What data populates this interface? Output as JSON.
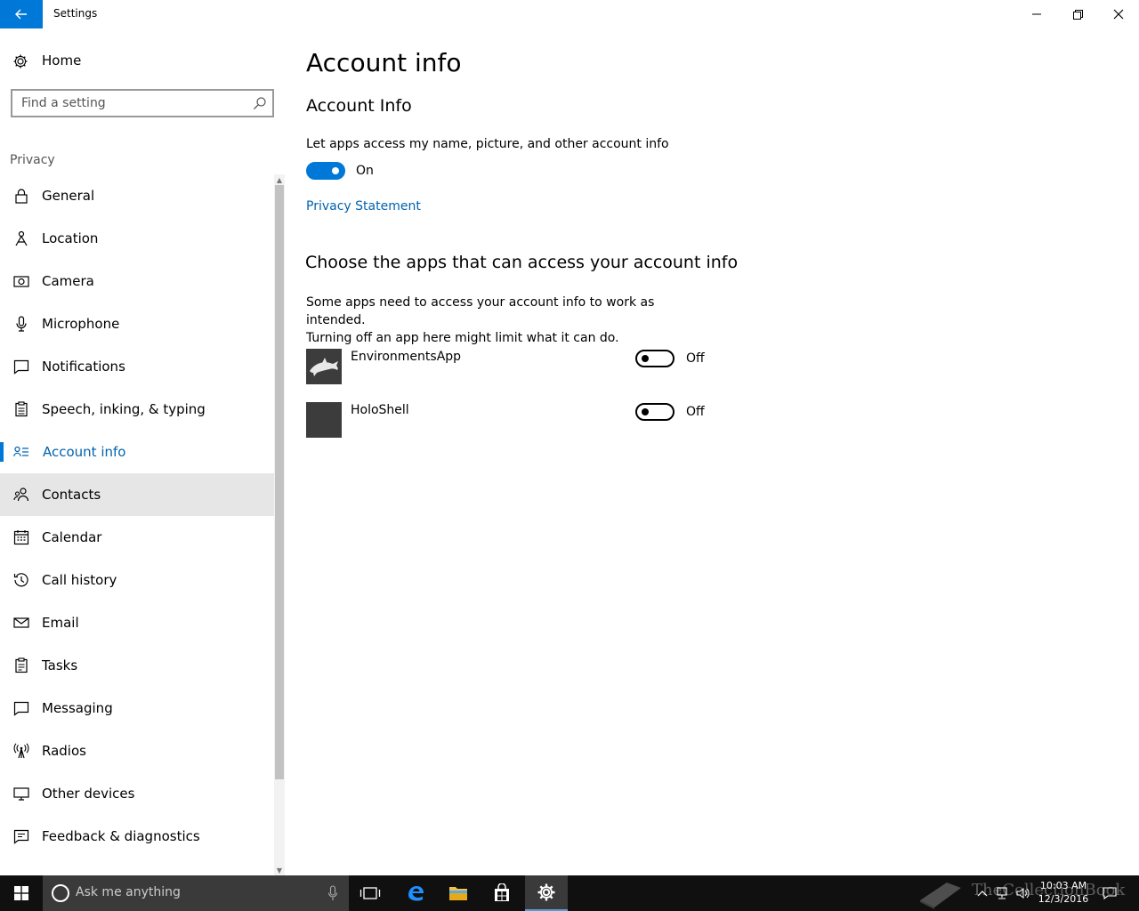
{
  "window": {
    "title": "Settings",
    "minimize_label": "Minimize",
    "restore_label": "Restore",
    "close_label": "Close"
  },
  "sidebar": {
    "home_label": "Home",
    "search_placeholder": "Find a setting",
    "section_label": "Privacy",
    "items": [
      {
        "label": "General",
        "icon": "lock-icon"
      },
      {
        "label": "Location",
        "icon": "location-icon"
      },
      {
        "label": "Camera",
        "icon": "camera-icon"
      },
      {
        "label": "Microphone",
        "icon": "microphone-icon"
      },
      {
        "label": "Notifications",
        "icon": "notifications-icon"
      },
      {
        "label": "Speech, inking, & typing",
        "icon": "speech-icon"
      },
      {
        "label": "Account info",
        "icon": "account-info-icon",
        "active": true
      },
      {
        "label": "Contacts",
        "icon": "contacts-icon",
        "hover": true
      },
      {
        "label": "Calendar",
        "icon": "calendar-icon"
      },
      {
        "label": "Call history",
        "icon": "history-icon"
      },
      {
        "label": "Email",
        "icon": "email-icon"
      },
      {
        "label": "Tasks",
        "icon": "tasks-icon"
      },
      {
        "label": "Messaging",
        "icon": "messaging-icon"
      },
      {
        "label": "Radios",
        "icon": "radios-icon"
      },
      {
        "label": "Other devices",
        "icon": "devices-icon"
      },
      {
        "label": "Feedback & diagnostics",
        "icon": "feedback-icon"
      }
    ]
  },
  "main": {
    "page_title": "Account info",
    "sub_title": "Account Info",
    "master_toggle_desc": "Let apps access my name, picture, and other account info",
    "master_toggle_state": "On",
    "privacy_link": "Privacy Statement",
    "apps_section_title": "Choose the apps that can access your account info",
    "apps_para_line1": "Some apps need to access your account info to work as intended.",
    "apps_para_line2": "Turning off an app here might limit what it can do.",
    "apps": [
      {
        "name": "EnvironmentsApp",
        "state": "Off",
        "icon": "dolphin-icon"
      },
      {
        "name": "HoloShell",
        "state": "Off",
        "icon": "app-placeholder-icon"
      }
    ]
  },
  "taskbar": {
    "search_placeholder": "Ask me anything",
    "clock_time": "10:03 AM",
    "clock_date": "12/3/2016",
    "watermark": "TheCollectionBook"
  },
  "colors": {
    "accent": "#0078d7",
    "link": "#0063b1",
    "taskbar": "#101010"
  }
}
